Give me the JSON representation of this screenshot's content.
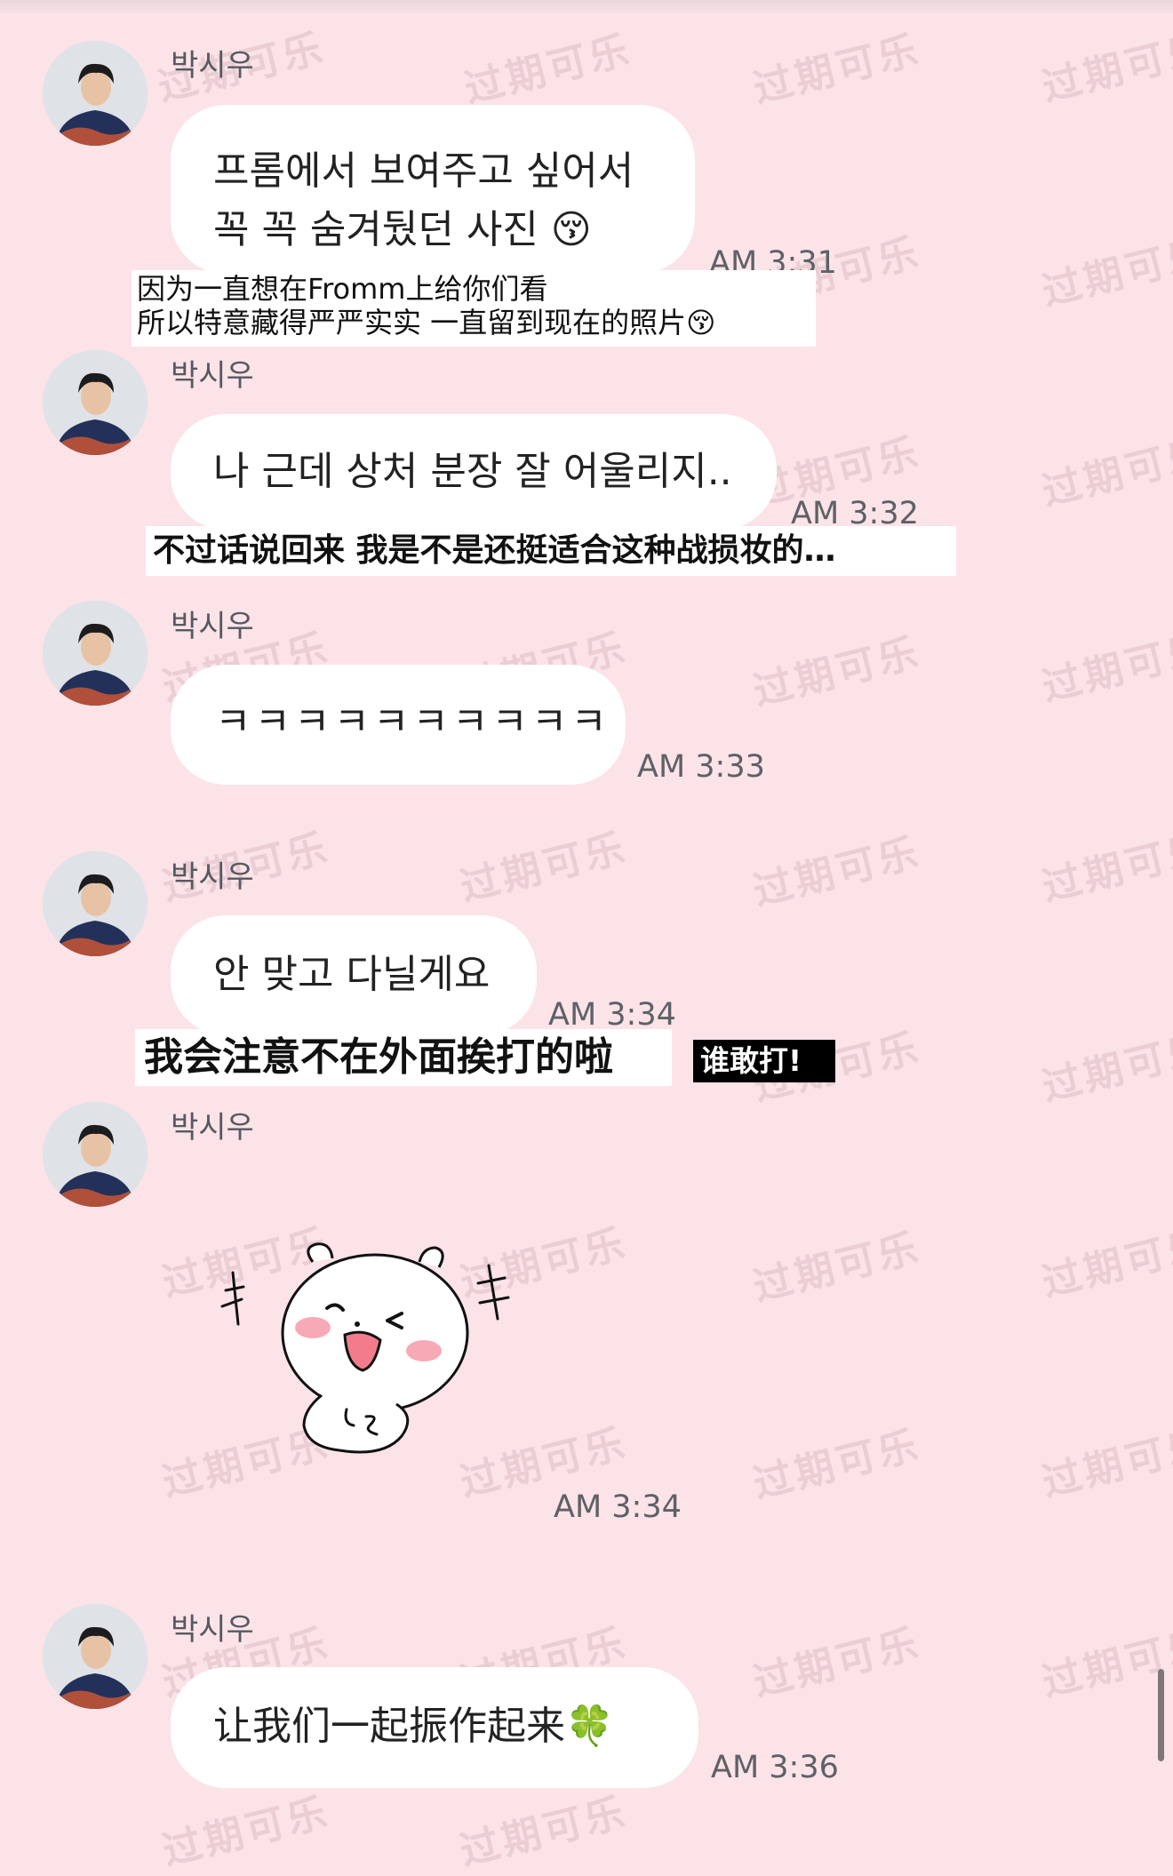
{
  "watermark": "过期可乐",
  "messages": [
    {
      "sender": "박시우",
      "lines": [
        "프롬에서 보여주고 싶어서",
        "꼭 꼭 숨겨뒀던 사진 😚"
      ],
      "time": "AM 3:31",
      "caption_lines": [
        "因为一直想在Fromm上给你们看",
        "所以特意藏得严严实实 一直留到现在的照片😚"
      ]
    },
    {
      "sender": "박시우",
      "lines": [
        "나 근데 상처 분장 잘 어울리지.."
      ],
      "time": "AM 3:32",
      "caption_lines": [
        "不过话说回来 我是不是还挺适合这种战损妆的…"
      ]
    },
    {
      "sender": "박시우",
      "lines": [
        "ㅋㅋㅋㅋㅋㅋㅋㅋㅋㅋ"
      ],
      "time": "AM 3:33"
    },
    {
      "sender": "박시우",
      "lines": [
        "안 맞고 다닐게요"
      ],
      "time": "AM 3:34",
      "caption_lines": [
        "我会注意不在外面挨打的啦"
      ],
      "badge": "谁敢打!"
    },
    {
      "sender": "박시우",
      "sticker": "smiling-bear-sticker",
      "time": "AM 3:34"
    },
    {
      "sender": "박시우",
      "lines": [
        "让我们一起振作起来🍀"
      ],
      "time": "AM 3:36"
    }
  ],
  "colors": {
    "background": "#fbe3e8",
    "bubble": "#ffffff",
    "time": "#5d6166",
    "name": "#555a60"
  }
}
